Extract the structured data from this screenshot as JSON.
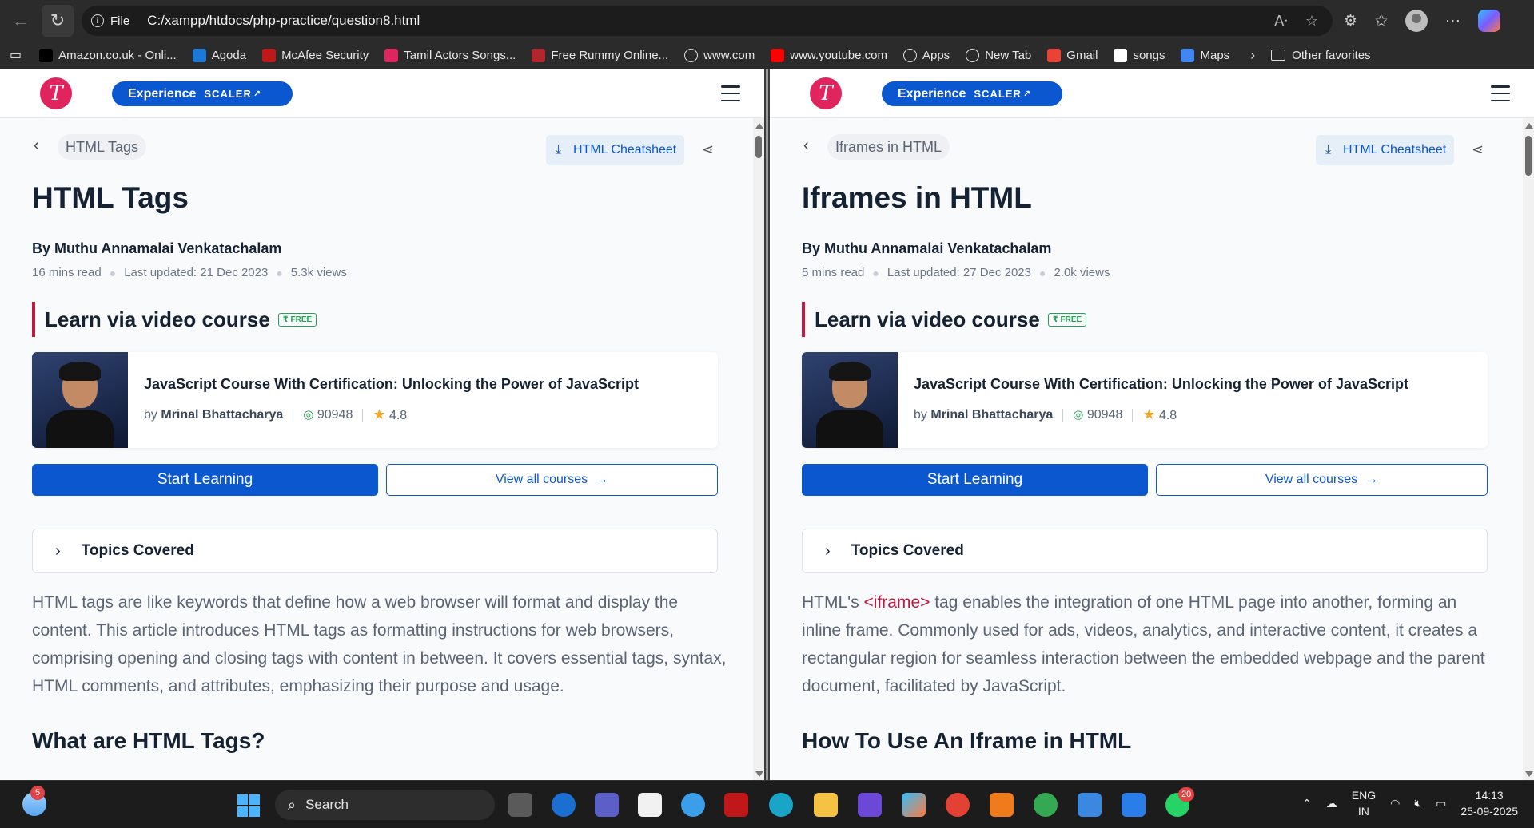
{
  "browser": {
    "url_scheme": "File",
    "url": "C:/xampp/htdocs/php-practice/question8.html",
    "favorites": [
      {
        "label": "Amazon.co.uk - Onli...",
        "icon": "amazon-icon",
        "color": "#000000"
      },
      {
        "label": "Agoda",
        "icon": "hp-icon",
        "color": "#1b7ad8"
      },
      {
        "label": "McAfee Security",
        "icon": "mcafee-icon",
        "color": "#c01818"
      },
      {
        "label": "Tamil Actors Songs...",
        "icon": "music-icon",
        "color": "#e0245e"
      },
      {
        "label": "Free Rummy Online...",
        "icon": "rummy-icon",
        "color": "#b3262e"
      },
      {
        "label": "www.com",
        "icon": "globe-icon",
        "color": ""
      },
      {
        "label": "www.youtube.com",
        "icon": "youtube-icon",
        "color": "#ff0000"
      },
      {
        "label": "Apps",
        "icon": "globe-icon",
        "color": ""
      },
      {
        "label": "New Tab",
        "icon": "globe-icon",
        "color": ""
      },
      {
        "label": "Gmail",
        "icon": "gmail-icon",
        "color": "#ea4335"
      },
      {
        "label": "songs",
        "icon": "youtube-icon",
        "color": "#ffffff"
      },
      {
        "label": "Maps",
        "icon": "google-icon",
        "color": "#4285f4"
      }
    ],
    "other_favorites": "Other favorites"
  },
  "header": {
    "logo_letter": "T",
    "experience_label": "Experience",
    "scaler_label": "SCALER"
  },
  "left": {
    "breadcrumb": "HTML Tags",
    "cheatsheet": "HTML Cheatsheet",
    "title": "HTML Tags",
    "author": "By Muthu Annamalai Venkatachalam",
    "read_time": "16 mins read",
    "updated": "Last updated: 21 Dec 2023",
    "views": "5.3k views",
    "video_heading": "Learn via video course",
    "free_badge": "₹ FREE",
    "course_title": "JavaScript Course With Certification: Unlocking the Power of JavaScript",
    "course_by": "by",
    "course_author": "Mrinal Bhattacharya",
    "enrolled": "90948",
    "rating": "4.8",
    "start_btn": "Start Learning",
    "view_btn": "View all courses",
    "topics": "Topics Covered",
    "intro": "HTML tags are like keywords that define how a web browser will format and display the content. This article introduces HTML tags as formatting instructions for web browsers, comprising opening and closing tags with content in between. It covers essential tags, syntax, HTML comments, and attributes, emphasizing their purpose and usage.",
    "section": "What are HTML Tags?"
  },
  "right": {
    "breadcrumb": "Iframes in HTML",
    "cheatsheet": "HTML Cheatsheet",
    "title": "Iframes in HTML",
    "author": "By Muthu Annamalai Venkatachalam",
    "read_time": "5 mins read",
    "updated": "Last updated: 27 Dec 2023",
    "views": "2.0k views",
    "video_heading": "Learn via video course",
    "free_badge": "₹ FREE",
    "course_title": "JavaScript Course With Certification: Unlocking the Power of JavaScript",
    "course_by": "by",
    "course_author": "Mrinal Bhattacharya",
    "enrolled": "90948",
    "rating": "4.8",
    "start_btn": "Start Learning",
    "view_btn": "View all courses",
    "topics": "Topics Covered",
    "intro_pre": "HTML's ",
    "intro_tag": "<iframe>",
    "intro_post": " tag enables the integration of one HTML page into another, forming an inline frame. Commonly used for ads, videos, analytics, and interactive content, it creates a rectangular region for seamless interaction between the embedded webpage and the parent document, facilitated by JavaScript.",
    "section": "How To Use An Iframe in HTML"
  },
  "taskbar": {
    "weather_badge": "5",
    "search": "Search",
    "whatsapp_badge": "20",
    "lang_top": "ENG",
    "lang_bottom": "IN",
    "time": "14:13",
    "date": "25-09-2025"
  },
  "colors": {
    "accent": "#0b57d0",
    "brand": "#e0245e",
    "heading_bar": "#c0173f",
    "free_green": "#23a155"
  }
}
